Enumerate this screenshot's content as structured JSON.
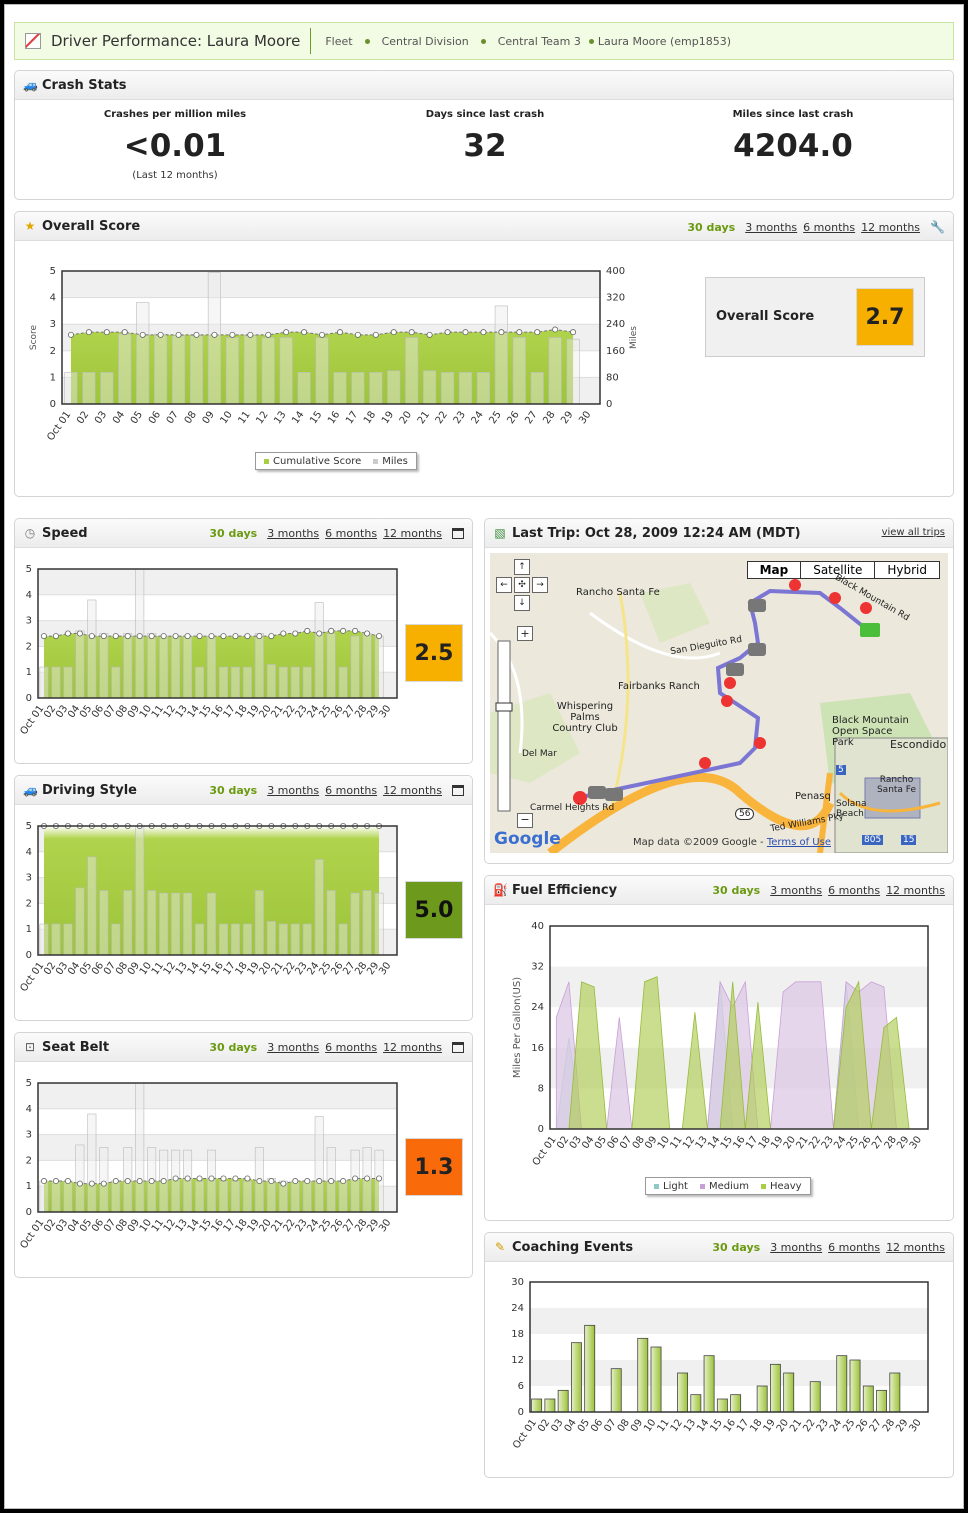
{
  "header": {
    "title": "Driver Performance: Laura Moore",
    "breadcrumb": [
      "Fleet",
      "Central Division",
      "Central Team 3",
      "Laura Moore (emp1853)"
    ]
  },
  "ranges": {
    "d30": "30 days",
    "m3": "3 months",
    "m6": "6 months",
    "m12": "12 months"
  },
  "crash": {
    "title": "Crash Stats",
    "stats": [
      {
        "label": "Crashes per million miles",
        "value": "<0.01",
        "note": "(Last 12 months)"
      },
      {
        "label": "Days since last crash",
        "value": "32",
        "note": ""
      },
      {
        "label": "Miles since last crash",
        "value": "4204.0",
        "note": ""
      }
    ]
  },
  "overall": {
    "title": "Overall Score",
    "score_label": "Overall Score",
    "score": "2.7",
    "score_color": "#f7b000",
    "legend": [
      "Cumulative Score",
      "Miles"
    ],
    "ylabel": "Score",
    "y2label": "Miles"
  },
  "speed": {
    "title": "Speed",
    "score": "2.5",
    "score_color": "#f7b000"
  },
  "style": {
    "title": "Driving Style",
    "score": "5.0",
    "score_color": "#6d9a1c"
  },
  "belt": {
    "title": "Seat Belt",
    "score": "1.3",
    "score_color": "#f86a0a"
  },
  "trip": {
    "title": "Last Trip: Oct 28, 2009 12:24 AM (MDT)",
    "view_all": "view all trips",
    "map_buttons": [
      "Map",
      "Satellite",
      "Hybrid"
    ],
    "map_labels": [
      "Rancho Santa Fe",
      "Fairbanks Ranch",
      "Whispering Palms Country Club",
      "Black Mountain Open Space Park",
      "Escondido",
      "Rancho Santa Fe",
      "Solana Beach",
      "Penasq",
      "Ted Williams Pky",
      "San Dieguito Rd",
      "Black Mountain Rd",
      "Carmel Heights Rd",
      "Del Mar",
      "56",
      "805",
      "15",
      "5"
    ],
    "attribution": "Map data ©2009 Google - ",
    "terms": "Terms of Use",
    "logo": "Google"
  },
  "fuel": {
    "title": "Fuel Efficiency",
    "ylabel": "Miles Per Gallon(US)",
    "legend": [
      "Light",
      "Medium",
      "Heavy"
    ]
  },
  "coach": {
    "title": "Coaching Events"
  },
  "colors": {
    "green": "#a9cd44",
    "gray_bar": "#e8e8e8",
    "purple": "#e2cfe8",
    "teal": "#cfe6e4"
  },
  "chart_data": [
    {
      "type": "bar",
      "title": "Overall Score",
      "x": [
        "Oct 01",
        "02",
        "03",
        "04",
        "05",
        "06",
        "07",
        "08",
        "09",
        "10",
        "11",
        "12",
        "13",
        "14",
        "15",
        "16",
        "17",
        "18",
        "19",
        "20",
        "21",
        "22",
        "23",
        "24",
        "25",
        "26",
        "27",
        "28",
        "29",
        "30"
      ],
      "series": [
        {
          "name": "Cumulative Score",
          "values": [
            2.6,
            2.7,
            2.7,
            2.7,
            2.6,
            2.6,
            2.6,
            2.6,
            2.6,
            2.6,
            2.6,
            2.6,
            2.7,
            2.7,
            2.6,
            2.7,
            2.6,
            2.6,
            2.7,
            2.7,
            2.6,
            2.7,
            2.7,
            2.7,
            2.7,
            2.7,
            2.7,
            2.8,
            2.7,
            null
          ]
        },
        {
          "name": "Miles",
          "values": [
            95,
            95,
            95,
            210,
            305,
            210,
            205,
            205,
            395,
            200,
            205,
            200,
            200,
            95,
            200,
            95,
            95,
            95,
            100,
            200,
            100,
            95,
            95,
            95,
            295,
            200,
            95,
            200,
            195,
            null
          ]
        }
      ],
      "ylim": [
        0,
        5
      ],
      "y2lim": [
        0,
        400
      ]
    },
    {
      "type": "bar",
      "title": "Speed",
      "x": [
        "Oct 01",
        "02",
        "03",
        "04",
        "05",
        "06",
        "07",
        "08",
        "09",
        "10",
        "11",
        "12",
        "13",
        "14",
        "15",
        "16",
        "17",
        "18",
        "19",
        "20",
        "21",
        "22",
        "23",
        "24",
        "25",
        "26",
        "27",
        "28",
        "29",
        "30"
      ],
      "series": [
        {
          "name": "Score",
          "values": [
            2.4,
            2.4,
            2.5,
            2.5,
            2.4,
            2.4,
            2.4,
            2.4,
            2.4,
            2.4,
            2.4,
            2.4,
            2.4,
            2.4,
            2.4,
            2.4,
            2.4,
            2.4,
            2.4,
            2.4,
            2.5,
            2.5,
            2.6,
            2.5,
            2.6,
            2.6,
            2.6,
            2.5,
            2.4,
            null
          ]
        },
        {
          "name": "Miles",
          "values": [
            1.2,
            1.2,
            1.2,
            2.6,
            3.8,
            2.5,
            1.2,
            2.5,
            5.0,
            2.5,
            2.4,
            2.4,
            2.4,
            1.2,
            2.4,
            1.2,
            1.2,
            1.2,
            2.5,
            1.3,
            1.2,
            1.2,
            1.2,
            3.7,
            2.5,
            1.2,
            2.4,
            2.5,
            2.4,
            null
          ]
        }
      ],
      "ylim": [
        0,
        5
      ]
    },
    {
      "type": "bar",
      "title": "Driving Style",
      "x": [
        "Oct 01",
        "02",
        "03",
        "04",
        "05",
        "06",
        "07",
        "08",
        "09",
        "10",
        "11",
        "12",
        "13",
        "14",
        "15",
        "16",
        "17",
        "18",
        "19",
        "20",
        "21",
        "22",
        "23",
        "24",
        "25",
        "26",
        "27",
        "28",
        "29",
        "30"
      ],
      "series": [
        {
          "name": "Score",
          "values": [
            5,
            5,
            5,
            5,
            5,
            5,
            5,
            5,
            5,
            5,
            5,
            5,
            5,
            5,
            5,
            5,
            5,
            5,
            5,
            5,
            5,
            5,
            5,
            5,
            5,
            5,
            5,
            5,
            5,
            null
          ]
        },
        {
          "name": "Miles",
          "values": [
            1.2,
            1.2,
            1.2,
            2.6,
            3.8,
            2.5,
            1.2,
            2.5,
            5.0,
            2.5,
            2.4,
            2.4,
            2.4,
            1.2,
            2.4,
            1.2,
            1.2,
            1.2,
            2.5,
            1.3,
            1.2,
            1.2,
            1.2,
            3.7,
            2.5,
            1.2,
            2.4,
            2.5,
            2.4,
            null
          ]
        }
      ],
      "ylim": [
        0,
        5
      ]
    },
    {
      "type": "bar",
      "title": "Seat Belt",
      "x": [
        "Oct 01",
        "02",
        "03",
        "04",
        "05",
        "06",
        "07",
        "08",
        "09",
        "10",
        "11",
        "12",
        "13",
        "14",
        "15",
        "16",
        "17",
        "18",
        "19",
        "20",
        "21",
        "22",
        "23",
        "24",
        "25",
        "26",
        "27",
        "28",
        "29",
        "30"
      ],
      "series": [
        {
          "name": "Score",
          "values": [
            1.2,
            1.2,
            1.2,
            1.1,
            1.1,
            1.1,
            1.2,
            1.2,
            1.2,
            1.2,
            1.2,
            1.3,
            1.3,
            1.3,
            1.3,
            1.3,
            1.3,
            1.3,
            1.2,
            1.2,
            1.1,
            1.2,
            1.2,
            1.2,
            1.2,
            1.2,
            1.3,
            1.3,
            1.3,
            null
          ]
        },
        {
          "name": "Miles",
          "values": [
            1.2,
            1.2,
            1.2,
            2.6,
            3.8,
            2.5,
            1.2,
            2.5,
            5.0,
            2.5,
            2.4,
            2.4,
            2.4,
            1.2,
            2.4,
            1.2,
            1.2,
            1.2,
            2.5,
            1.3,
            1.2,
            1.2,
            1.2,
            3.7,
            2.5,
            1.2,
            2.4,
            2.5,
            2.4,
            null
          ]
        }
      ],
      "ylim": [
        0,
        5
      ]
    },
    {
      "type": "area",
      "title": "Fuel Efficiency",
      "x": [
        "Oct 01",
        "02",
        "03",
        "04",
        "05",
        "06",
        "07",
        "08",
        "09",
        "10",
        "11",
        "12",
        "13",
        "14",
        "15",
        "16",
        "17",
        "18",
        "19",
        "20",
        "21",
        "22",
        "23",
        "24",
        "25",
        "26",
        "27",
        "28",
        "29",
        "30"
      ],
      "series": [
        {
          "name": "Light",
          "values": [
            0,
            18,
            0,
            0,
            0,
            0,
            0,
            0,
            0,
            0,
            0,
            0,
            0,
            29,
            0,
            0,
            0,
            0,
            0,
            0,
            0,
            0,
            0,
            29,
            0,
            0,
            0,
            0,
            0,
            0
          ]
        },
        {
          "name": "Medium",
          "values": [
            22,
            29,
            0,
            0,
            0,
            22,
            0,
            0,
            0,
            0,
            0,
            0,
            0,
            29,
            24,
            29,
            0,
            0,
            27,
            29,
            29,
            29,
            0,
            29,
            27,
            29,
            28,
            0,
            0,
            0
          ]
        },
        {
          "name": "Heavy",
          "values": [
            0,
            0,
            29,
            28,
            0,
            0,
            0,
            29,
            30,
            0,
            0,
            23,
            0,
            0,
            29,
            0,
            25,
            0,
            0,
            0,
            0,
            0,
            0,
            24,
            29,
            0,
            20,
            22,
            0,
            0
          ]
        }
      ],
      "ylim": [
        0,
        40
      ]
    },
    {
      "type": "bar",
      "title": "Coaching Events",
      "x": [
        "Oct 01",
        "02",
        "03",
        "04",
        "05",
        "06",
        "07",
        "08",
        "09",
        "10",
        "11",
        "12",
        "13",
        "14",
        "15",
        "16",
        "17",
        "18",
        "19",
        "20",
        "21",
        "22",
        "23",
        "24",
        "25",
        "26",
        "27",
        "28",
        "29",
        "30"
      ],
      "values": [
        3,
        3,
        5,
        16,
        20,
        0,
        10,
        0,
        17,
        15,
        0,
        9,
        4,
        13,
        3,
        4,
        0,
        6,
        11,
        9,
        0,
        7,
        0,
        13,
        12,
        6,
        5,
        9,
        0,
        0
      ],
      "ylim": [
        0,
        30
      ]
    }
  ]
}
